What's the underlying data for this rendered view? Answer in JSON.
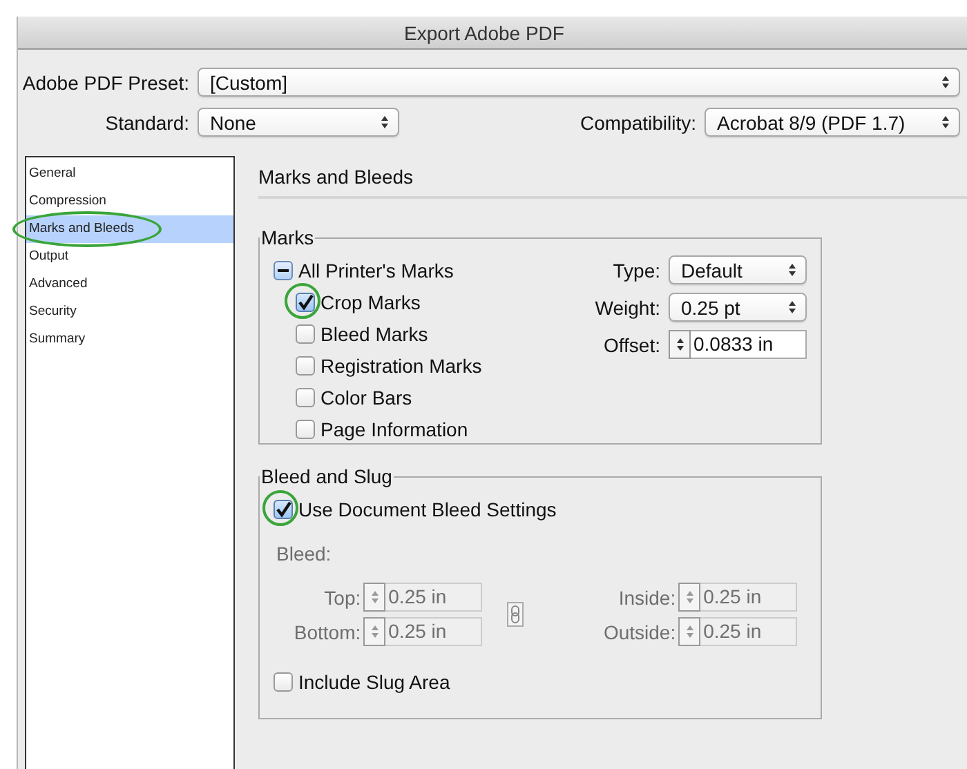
{
  "window": {
    "title": "Export Adobe PDF"
  },
  "preset": {
    "label": "Adobe PDF Preset:",
    "value": "[Custom]"
  },
  "standard": {
    "label": "Standard:",
    "value": "None"
  },
  "compatibility": {
    "label": "Compatibility:",
    "value": "Acrobat 8/9 (PDF 1.7)"
  },
  "sidebar": {
    "items": [
      {
        "label": "General",
        "selected": false
      },
      {
        "label": "Compression",
        "selected": false
      },
      {
        "label": "Marks and Bleeds",
        "selected": true,
        "circled": true
      },
      {
        "label": "Output",
        "selected": false
      },
      {
        "label": "Advanced",
        "selected": false
      },
      {
        "label": "Security",
        "selected": false
      },
      {
        "label": "Summary",
        "selected": false
      }
    ]
  },
  "panel": {
    "title": "Marks and Bleeds"
  },
  "marks": {
    "title": "Marks",
    "options": [
      {
        "label": "All Printer's Marks",
        "mixed": true,
        "children": [
          {
            "label": "Crop Marks",
            "checked": true,
            "circled": true
          },
          {
            "label": "Bleed Marks",
            "checked": false
          },
          {
            "label": "Registration Marks",
            "checked": false
          },
          {
            "label": "Color Bars",
            "checked": false
          },
          {
            "label": "Page Information",
            "checked": false
          }
        ]
      }
    ],
    "fields": [
      {
        "label": "Type:",
        "kind": "select",
        "value": "Default"
      },
      {
        "label": "Weight:",
        "kind": "select",
        "value": "0.25 pt"
      },
      {
        "label": "Offset:",
        "kind": "stepper",
        "value": "0.0833 in"
      }
    ]
  },
  "bleed_and_slug": {
    "title": "Bleed and Slug",
    "use_document_bleed": {
      "label": "Use Document Bleed Settings",
      "checked": true,
      "circled": true
    },
    "bleed": {
      "label": "Bleed:",
      "disabled": true,
      "fields": [
        {
          "label": "Top:",
          "value": "0.25 in"
        },
        {
          "label": "Inside:",
          "value": "0.25 in"
        },
        {
          "label": "Bottom:",
          "value": "0.25 in"
        },
        {
          "label": "Outside:",
          "value": "0.25 in"
        }
      ]
    },
    "include_slug": {
      "label": "Include Slug Area",
      "checked": false
    }
  }
}
